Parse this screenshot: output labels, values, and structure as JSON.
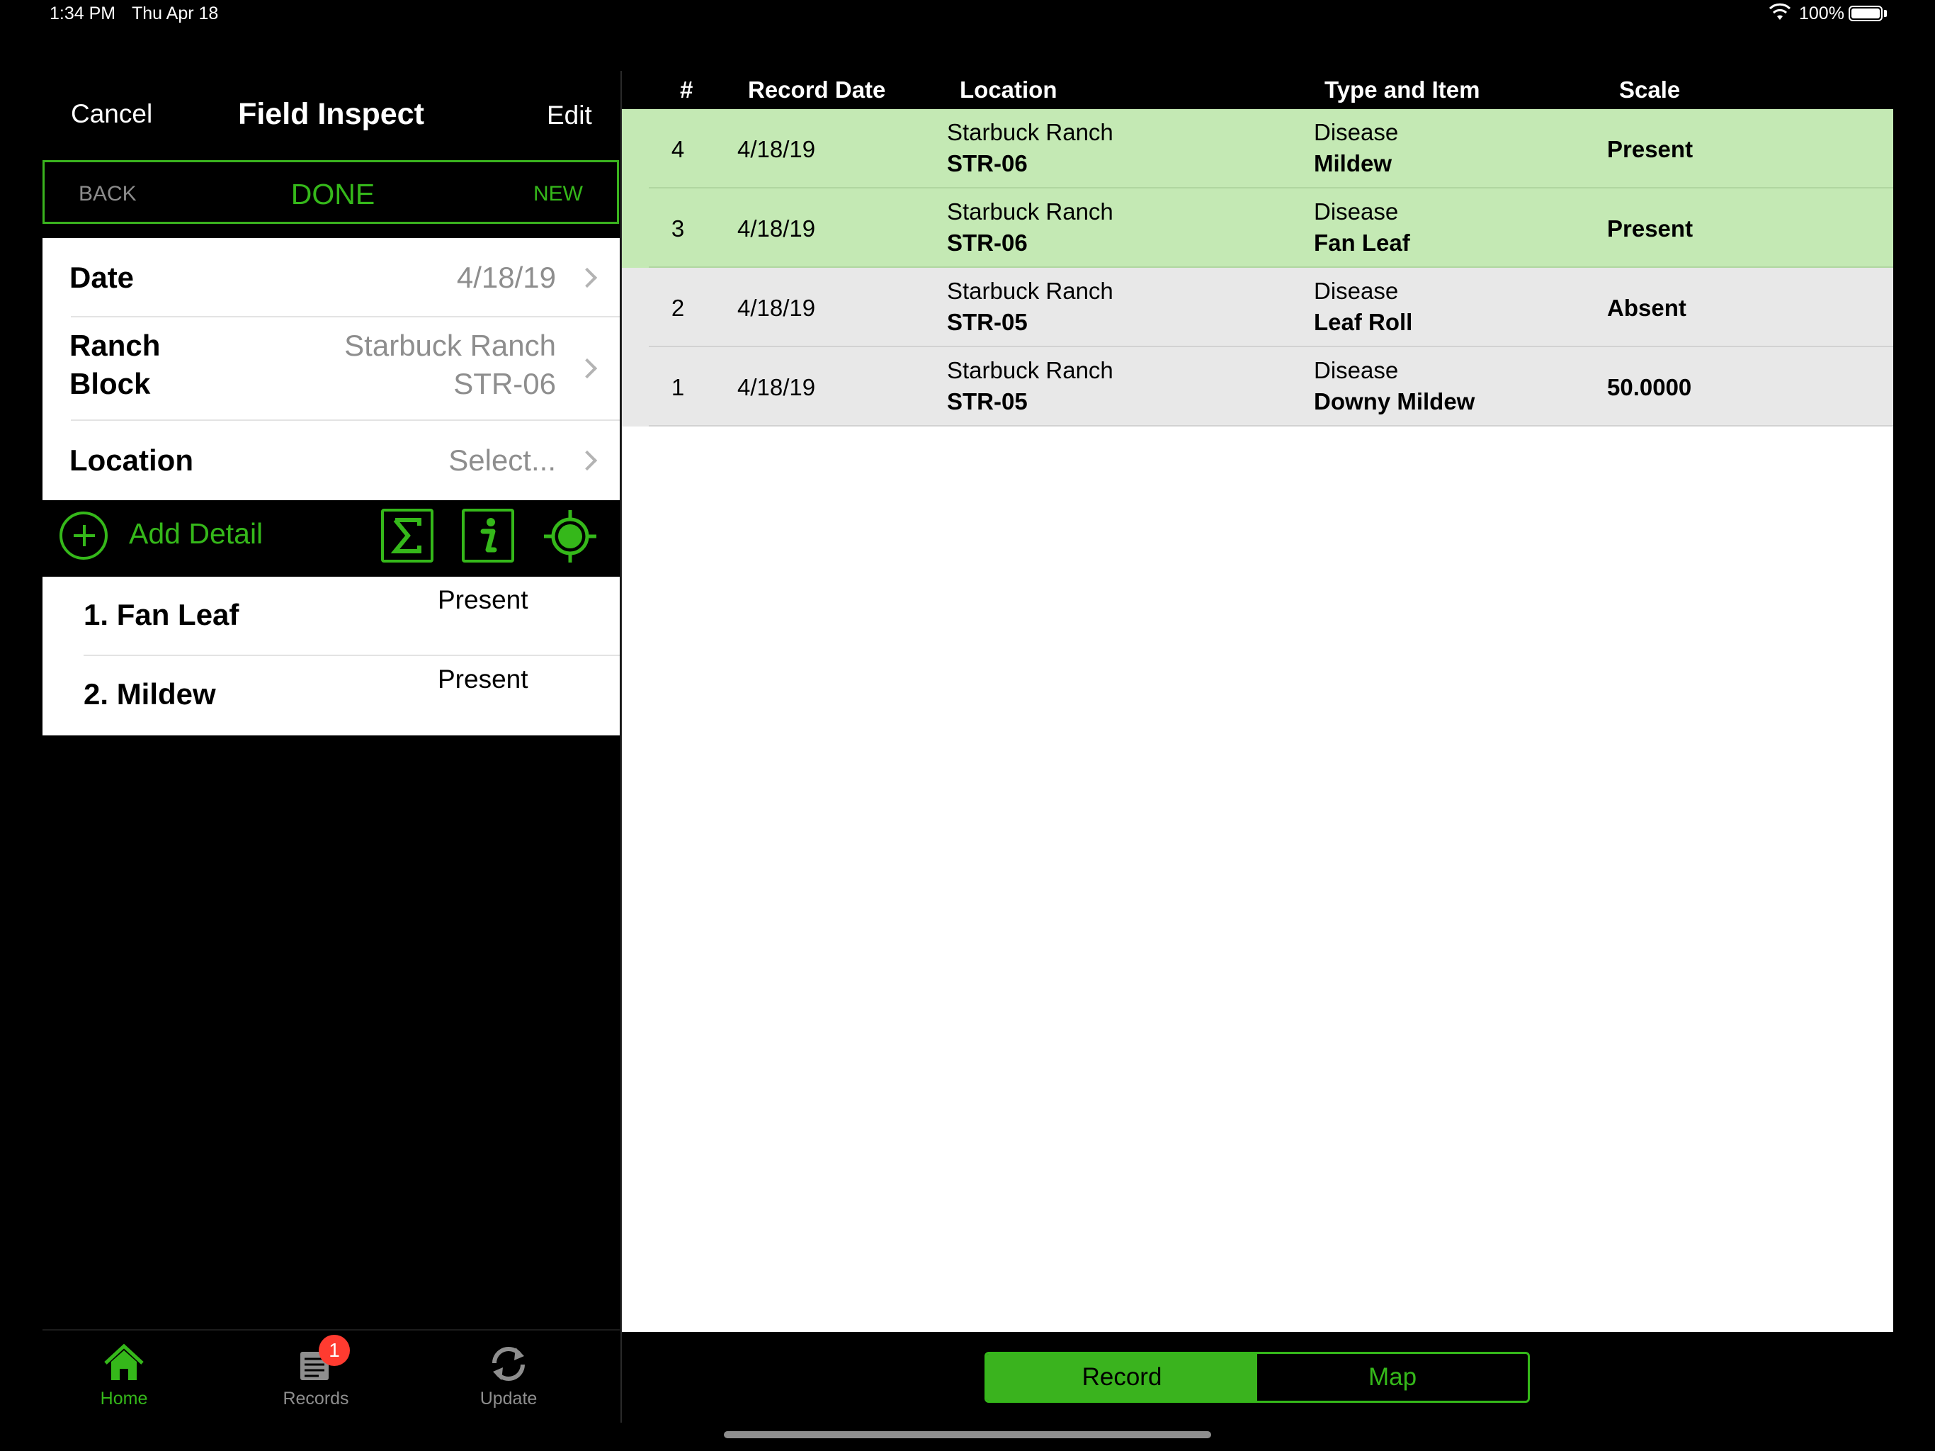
{
  "status_bar": {
    "time": "1:34 PM",
    "date": "Thu Apr 18",
    "battery": "100%"
  },
  "nav": {
    "cancel": "Cancel",
    "title": "Field Inspect",
    "edit": "Edit"
  },
  "segment": {
    "back": "BACK",
    "done": "DONE",
    "new": "NEW"
  },
  "form": {
    "date_label": "Date",
    "date_value": "4/18/19",
    "ranch_label": "Ranch",
    "ranch_value": "Starbuck Ranch",
    "block_label": "Block",
    "block_value": "STR-06",
    "location_label": "Location",
    "location_value": "Select..."
  },
  "toolbar": {
    "add_detail": "Add Detail",
    "icons": [
      "add-icon",
      "sigma-icon",
      "info-icon",
      "target-icon"
    ]
  },
  "details": [
    {
      "label": "1. Fan Leaf",
      "scale": "Present"
    },
    {
      "label": "2. Mildew",
      "scale": "Present"
    }
  ],
  "tabs": [
    {
      "label": "Home",
      "icon": "home-icon"
    },
    {
      "label": "Records",
      "icon": "records-icon",
      "badge": "1"
    },
    {
      "label": "Update",
      "icon": "update-icon"
    }
  ],
  "table": {
    "headers": {
      "num": "#",
      "date": "Record Date",
      "location": "Location",
      "type": "Type and Item",
      "scale": "Scale"
    },
    "rows": [
      {
        "num": "4",
        "date": "4/18/19",
        "ranch": "Starbuck Ranch",
        "block": "STR-06",
        "type": "Disease",
        "item": "Mildew",
        "scale": "Present"
      },
      {
        "num": "3",
        "date": "4/18/19",
        "ranch": "Starbuck Ranch",
        "block": "STR-06",
        "type": "Disease",
        "item": "Fan Leaf",
        "scale": "Present"
      },
      {
        "num": "2",
        "date": "4/18/19",
        "ranch": "Starbuck Ranch",
        "block": "STR-05",
        "type": "Disease",
        "item": "Leaf Roll",
        "scale": "Absent"
      },
      {
        "num": "1",
        "date": "4/18/19",
        "ranch": "Starbuck Ranch",
        "block": "STR-05",
        "type": "Disease",
        "item": "Downy Mildew",
        "scale": "50.0000"
      }
    ]
  },
  "bottom_segment": {
    "record": "Record",
    "map": "Map"
  },
  "colors": {
    "accent": "#35b81a",
    "row_highlight": "#c4e9b4",
    "row_default": "#e8e8e8",
    "badge": "#ff3b30"
  }
}
